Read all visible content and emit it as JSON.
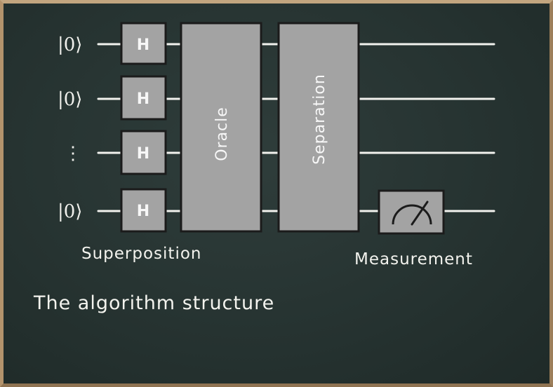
{
  "wires": {
    "labels": [
      "|0⟩",
      "|0⟩",
      "⋮",
      "|0⟩"
    ]
  },
  "gates": {
    "hadamard_label": "H",
    "oracle_label": "Oracle",
    "separation_label": "Separation"
  },
  "annotations": {
    "superposition": "Superposition",
    "measurement": "Measurement",
    "caption": "The algorithm structure"
  },
  "colors": {
    "board": "#263331",
    "frame": "#a98a64",
    "gate_fill": "#a3a3a3",
    "chalk": "#f2f2ee"
  },
  "icons": {
    "measurement": "meter-icon"
  }
}
